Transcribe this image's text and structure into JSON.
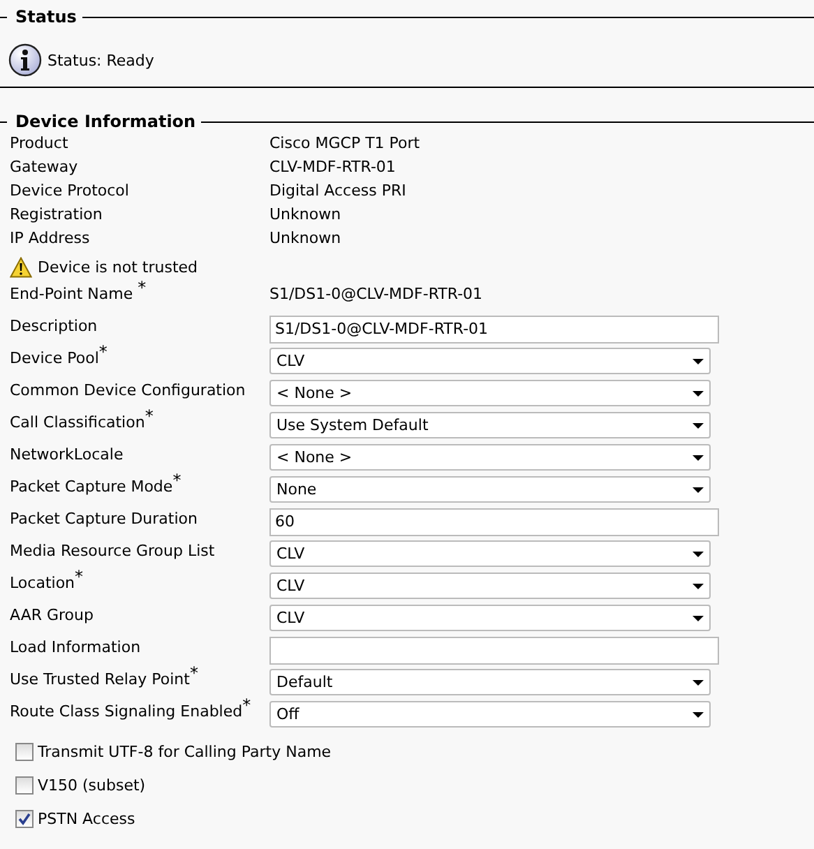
{
  "status": {
    "title": "Status",
    "message": "Status: Ready"
  },
  "device_information": {
    "title": "Device Information",
    "info_rows": [
      {
        "label": "Product",
        "value": "Cisco MGCP T1 Port"
      },
      {
        "label": "Gateway",
        "value": "CLV-MDF-RTR-01"
      },
      {
        "label": "Device Protocol",
        "value": "Digital Access PRI"
      },
      {
        "label": "Registration",
        "value": "Unknown"
      },
      {
        "label": "IP Address",
        "value": "Unknown"
      }
    ],
    "warning": "Device is not trusted",
    "form_rows": [
      {
        "kind": "static",
        "label": "End-Point Name $^{*}$",
        "value": "S1/DS1-0@CLV-MDF-RTR-01"
      },
      {
        "kind": "text",
        "label": "Description",
        "value": "S1/DS1-0@CLV-MDF-RTR-01"
      },
      {
        "kind": "select",
        "label": "Device Pool$^{*}$",
        "value": "CLV"
      },
      {
        "kind": "select",
        "label": "Common Device Configuration",
        "value": "< None >"
      },
      {
        "kind": "select",
        "label": "Call Classification$^{*}$",
        "value": "Use System Default"
      },
      {
        "kind": "select",
        "label": "NetworkLocale",
        "value": "< None >"
      },
      {
        "kind": "select",
        "label": "Packet Capture Mode$^{*}$",
        "value": "None"
      },
      {
        "kind": "text",
        "label": "Packet Capture Duration",
        "value": "60"
      },
      {
        "kind": "select",
        "label": "Media Resource Group List",
        "value": "CLV"
      },
      {
        "kind": "select",
        "label": "Location$^{*}$",
        "value": "CLV"
      },
      {
        "kind": "select",
        "label": "AAR Group",
        "value": "CLV"
      },
      {
        "kind": "text",
        "label": "Load Information"
      },
      {
        "kind": "select",
        "label": "Use Trusted Relay Point$^{*}$",
        "value": "Default"
      },
      {
        "kind": "select",
        "label": "Route Class Signaling Enabled$^{*}$",
        "value": "Off"
      }
    ],
    "checkboxes": [
      {
        "label": "Transmit UTF-8 for Calling Party Name",
        "checked": false
      },
      {
        "label": "V150 (subset)",
        "checked": false
      },
      {
        "label": "PSTN Access",
        "checked": true
      }
    ]
  }
}
